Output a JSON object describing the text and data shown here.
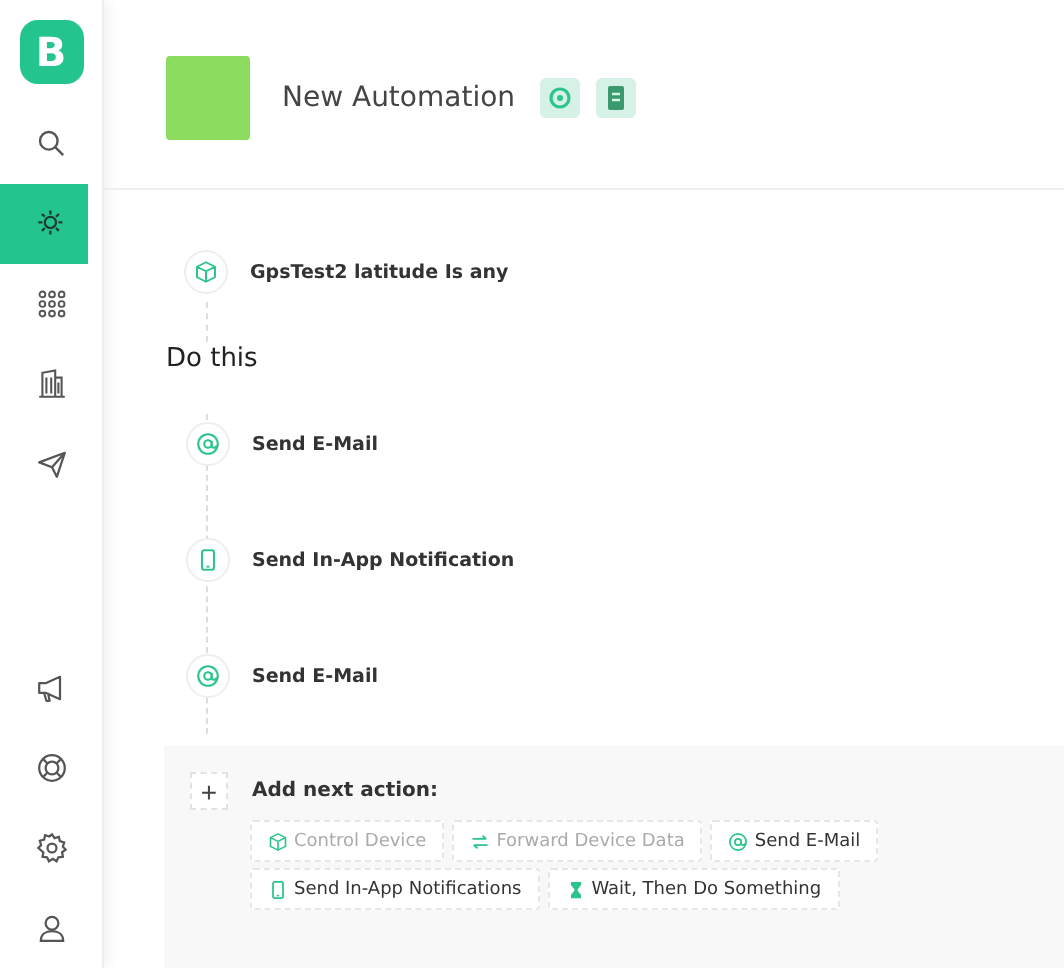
{
  "logo": {
    "letter": "B"
  },
  "sidebar": {
    "items": [
      {
        "kind": "search",
        "selected": false
      },
      {
        "kind": "automation",
        "selected": true
      },
      {
        "kind": "grid",
        "selected": false
      },
      {
        "kind": "building",
        "selected": false
      },
      {
        "kind": "send",
        "selected": false
      }
    ],
    "bottom_items": [
      {
        "kind": "megaphone"
      },
      {
        "kind": "lifebuoy"
      },
      {
        "kind": "settings"
      },
      {
        "kind": "user"
      }
    ]
  },
  "header": {
    "title": "New Automation"
  },
  "trigger": {
    "kind": "device",
    "label": "GpsTest2 latitude Is any"
  },
  "actions_heading": "Do this",
  "actions": [
    {
      "kind": "email",
      "label": "Send E-Mail"
    },
    {
      "kind": "notification",
      "label": "Send In-App Notification"
    },
    {
      "kind": "email",
      "label": "Send E-Mail"
    }
  ],
  "add_panel": {
    "plus": "+",
    "label": "Add next action:",
    "options": [
      {
        "kind": "device",
        "label": "Control Device",
        "disabled": true
      },
      {
        "kind": "forward",
        "label": "Forward Device Data",
        "disabled": true
      },
      {
        "kind": "email",
        "label": "Send E-Mail",
        "disabled": false
      },
      {
        "kind": "notification",
        "label": "Send In-App Notifications",
        "disabled": false
      },
      {
        "kind": "wait",
        "label": "Wait, Then Do Something",
        "disabled": false
      }
    ]
  }
}
